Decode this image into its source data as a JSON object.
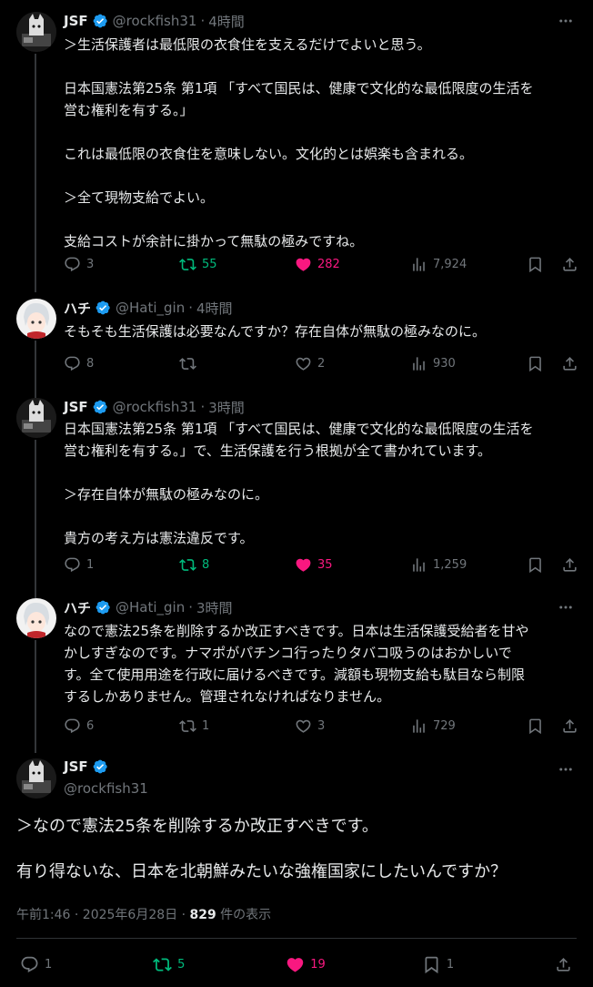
{
  "tweets": [
    {
      "name": "JSF",
      "handle": "@rockfish31",
      "time": "4時間",
      "lines": [
        "＞生活保護者は最低限の衣食住を支えるだけでよいと思う。",
        "",
        "日本国憲法第25条 第1項 「すべて国民は、健康で文化的な最低限度の生活を",
        "営む権利を有する。」",
        "",
        "これは最低限の衣食住を意味しない。文化的とは娯楽も含まれる。",
        "",
        "＞全て現物支給でよい。",
        "",
        "支給コストが余計に掛かって無駄の極みですね。"
      ],
      "replies": "3",
      "retweets": "55",
      "likes": "282",
      "views": "7,924"
    },
    {
      "name": "ハチ",
      "handle": "@Hati_gin",
      "time": "4時間",
      "lines": [
        "そもそも生活保護は必要なんですか？存在自体が無駄の極みなのに。"
      ],
      "replies": "8",
      "retweets": "",
      "likes": "2",
      "views": "930"
    },
    {
      "name": "JSF",
      "handle": "@rockfish31",
      "time": "3時間",
      "lines": [
        "日本国憲法第25条 第1項 「すべて国民は、健康で文化的な最低限度の生活を",
        "営む権利を有する。」で、生活保護を行う根拠が全て書かれています。",
        "",
        "＞存在自体が無駄の極みなのに。",
        "",
        "貴方の考え方は憲法違反です。"
      ],
      "replies": "1",
      "retweets": "8",
      "likes": "35",
      "views": "1,259"
    },
    {
      "name": "ハチ",
      "handle": "@Hati_gin",
      "time": "3時間",
      "lines": [
        "なので憲法25条を削除するか改正すべきです。日本は生活保護受給者を甘や",
        "かしすぎなのです。ナマポがパチンコ行ったりタバコ吸うのはおかしいで",
        "す。全て使用用途を行政に届けるべきです。減額も現物支給も駄目なら制限",
        "するしかありません。管理されなければなりません。"
      ],
      "replies": "6",
      "retweets": "1",
      "likes": "3",
      "views": "729"
    }
  ],
  "main": {
    "name": "JSF",
    "handle": "@rockfish31",
    "lines": [
      "＞なので憲法25条を削除するか改正すべきです。",
      "",
      "有り得ないな、日本を北朝鮮みたいな強権国家にしたいんですか？"
    ],
    "timestamp": "午前1:46 · 2025年6月28日 · ",
    "view_count": "829",
    "view_suffix": " 件の表示",
    "replies": "1",
    "retweets": "5",
    "likes": "19",
    "bookmarks": "1"
  },
  "colors": {
    "background": "#000000",
    "text": "#e7e9ea",
    "muted": "#71767b",
    "verified": "#1d9bf0",
    "retweet": "#00ba7c",
    "like": "#f91880"
  },
  "icons": {
    "reply": "reply-icon",
    "retweet": "retweet-icon",
    "like": "heart-icon",
    "views": "views-icon",
    "bookmark": "bookmark-icon",
    "share": "share-icon",
    "more": "more-icon",
    "verified": "verified-badge-icon"
  }
}
